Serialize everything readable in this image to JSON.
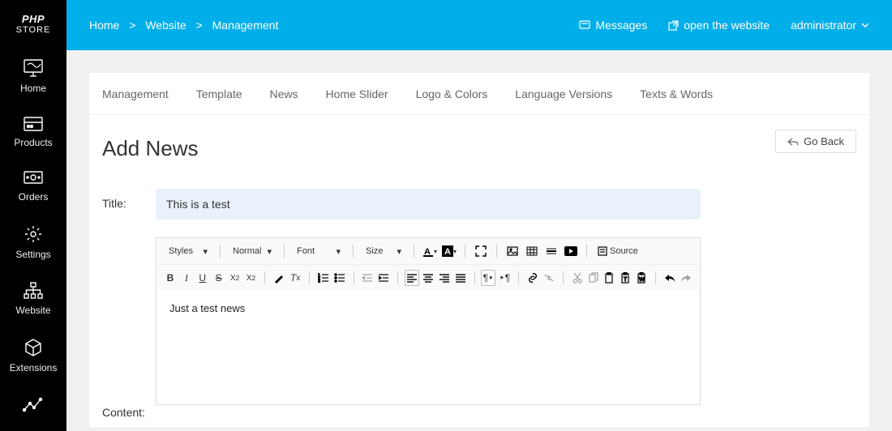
{
  "logo": {
    "line1": "PHP",
    "line2": "STORE"
  },
  "sidebar": [
    {
      "label": "Home"
    },
    {
      "label": "Products"
    },
    {
      "label": "Orders"
    },
    {
      "label": "Settings"
    },
    {
      "label": "Website"
    },
    {
      "label": "Extensions"
    }
  ],
  "breadcrumbs": {
    "a": "Home",
    "b": "Website",
    "c": "Management",
    "sep": ">"
  },
  "topbar": {
    "messages": "Messages",
    "openSite": "open the website",
    "user": "administrator"
  },
  "tabs": [
    {
      "label": "Management"
    },
    {
      "label": "Template"
    },
    {
      "label": "News"
    },
    {
      "label": "Home Slider"
    },
    {
      "label": "Logo & Colors"
    },
    {
      "label": "Language Versions"
    },
    {
      "label": "Texts & Words"
    }
  ],
  "goBack": "Go Back",
  "pageTitle": "Add News",
  "titleLabel": "Title:",
  "titleValue": "This is a test",
  "contentLabel": "Content:",
  "editorBody": "Just a test news",
  "toolbar": {
    "styles": "Styles",
    "normal": "Normal",
    "font": "Font",
    "size": "Size",
    "source": "Source"
  }
}
